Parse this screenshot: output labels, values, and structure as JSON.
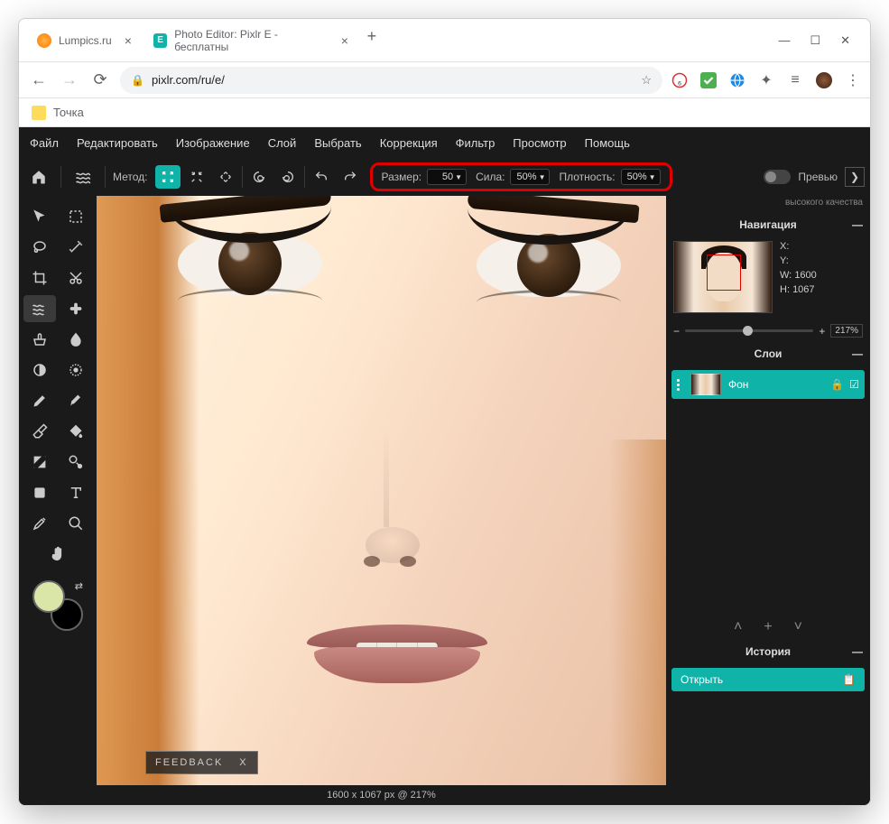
{
  "browser": {
    "tabs": [
      {
        "title": "Lumpics.ru",
        "active": false
      },
      {
        "title": "Photo Editor: Pixlr E - бесплатны",
        "active": true,
        "badge": "E"
      }
    ],
    "url": "pixlr.com/ru/e/",
    "bookmark": "Точка"
  },
  "menu": [
    "Файл",
    "Редактировать",
    "Изображение",
    "Слой",
    "Выбрать",
    "Коррекция",
    "Фильтр",
    "Просмотр",
    "Помощь"
  ],
  "options": {
    "method_label": "Метод:",
    "size_label": "Размер:",
    "size_val": "50",
    "strength_label": "Сила:",
    "strength_val": "50%",
    "density_label": "Плотность:",
    "density_val": "50%",
    "preview_label": "Превью"
  },
  "nav": {
    "title": "Навигация",
    "quality": "высокого качества",
    "x": "X:",
    "y": "Y:",
    "w_label": "W:",
    "w": "1600",
    "h_label": "H:",
    "h": "1067",
    "zoom": "217%"
  },
  "layers": {
    "title": "Слои",
    "item": "Фон"
  },
  "history": {
    "title": "История",
    "item": "Открыть"
  },
  "footer": {
    "feedback": "FEEDBACK",
    "feedback_x": "X",
    "status": "1600 x 1067 px @ 217%"
  }
}
